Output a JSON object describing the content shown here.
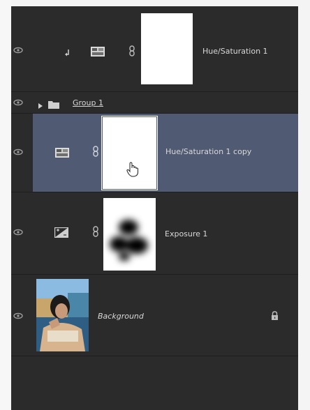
{
  "layers": [
    {
      "id": "hue_sat_1",
      "name": "Hue/Saturation 1",
      "type": "adjustment",
      "clipped": true
    },
    {
      "id": "group_1",
      "name": "Group 1",
      "type": "group",
      "collapsed": true
    },
    {
      "id": "hue_sat_1_copy",
      "name": "Hue/Saturation 1 copy",
      "type": "adjustment",
      "selected": true
    },
    {
      "id": "exposure_1",
      "name": "Exposure 1",
      "type": "adjustment"
    },
    {
      "id": "background",
      "name": "Background",
      "type": "image",
      "locked": true
    }
  ],
  "icons": {
    "eye": "eye-icon",
    "clip": "clip-arrow-icon",
    "hue": "hue-saturation-icon",
    "exposure": "exposure-icon",
    "link": "chain-link-icon",
    "folder": "folder-icon",
    "lock": "lock-icon",
    "cursor": "hand-cursor-icon"
  },
  "colors": {
    "panel": "#2b2b2b",
    "selected_row": "#515a73"
  }
}
